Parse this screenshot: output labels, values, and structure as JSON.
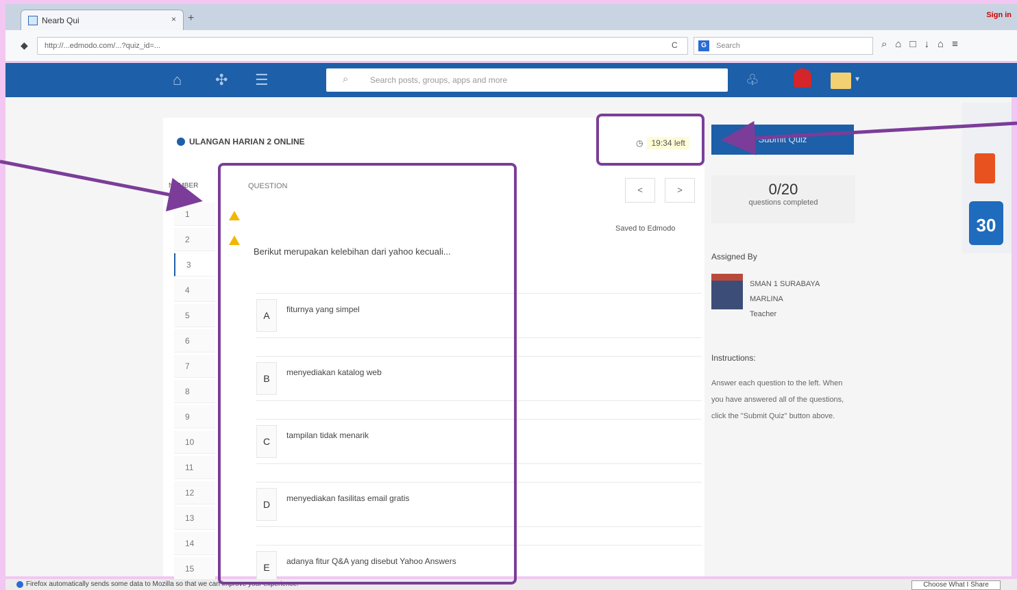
{
  "browser": {
    "tab_title": "Nearb Qui",
    "url": "http://...edmodo.com/...?quiz_id=...",
    "search_placeholder": "Search",
    "window_controls": "Sign in",
    "status_text": "Firefox automatically sends some data to Mozilla so that we can improve your experience.",
    "status_button": "Choose What I Share"
  },
  "app": {
    "search_placeholder": "Search posts, groups, apps and more",
    "brand_color": "#1d5fa8"
  },
  "quiz": {
    "title": "ULANGAN HARIAN 2 ONLINE",
    "timer": "19:34 left",
    "numbers_header": "NUMBER",
    "question_header": "QUESTION",
    "prev": "<",
    "next": ">",
    "saved_text": "Saved to Edmodo",
    "question_text": "Berikut merupakan kelebihan dari yahoo kecuali...",
    "question_numbers": [
      "1",
      "2",
      "3",
      "4",
      "5",
      "6",
      "7",
      "8",
      "9",
      "10",
      "11",
      "12",
      "13",
      "14",
      "15"
    ],
    "options": [
      {
        "letter": "A",
        "text": "fiturnya yang simpel"
      },
      {
        "letter": "B",
        "text": "menyediakan katalog web"
      },
      {
        "letter": "C",
        "text": "tampilan tidak menarik"
      },
      {
        "letter": "D",
        "text": "menyediakan fasilitas email gratis"
      },
      {
        "letter": "E",
        "text": "adanya fitur Q&A yang disebut Yahoo Answers"
      }
    ]
  },
  "sidebar": {
    "submit_label": "Submit Quiz",
    "progress_value": "0/20",
    "progress_label": "questions completed",
    "assigned_label": "Assigned By",
    "teacher_line1": "SMAN 1 SURABAYA",
    "teacher_line2": "MARLINA",
    "teacher_line3": "Teacher",
    "instructions_label": "Instructions:",
    "instructions_text": "Answer each question to the left. When you have answered all of the questions, click the \"Submit Quiz\" button above."
  },
  "annotation_color": "#7b3d99"
}
